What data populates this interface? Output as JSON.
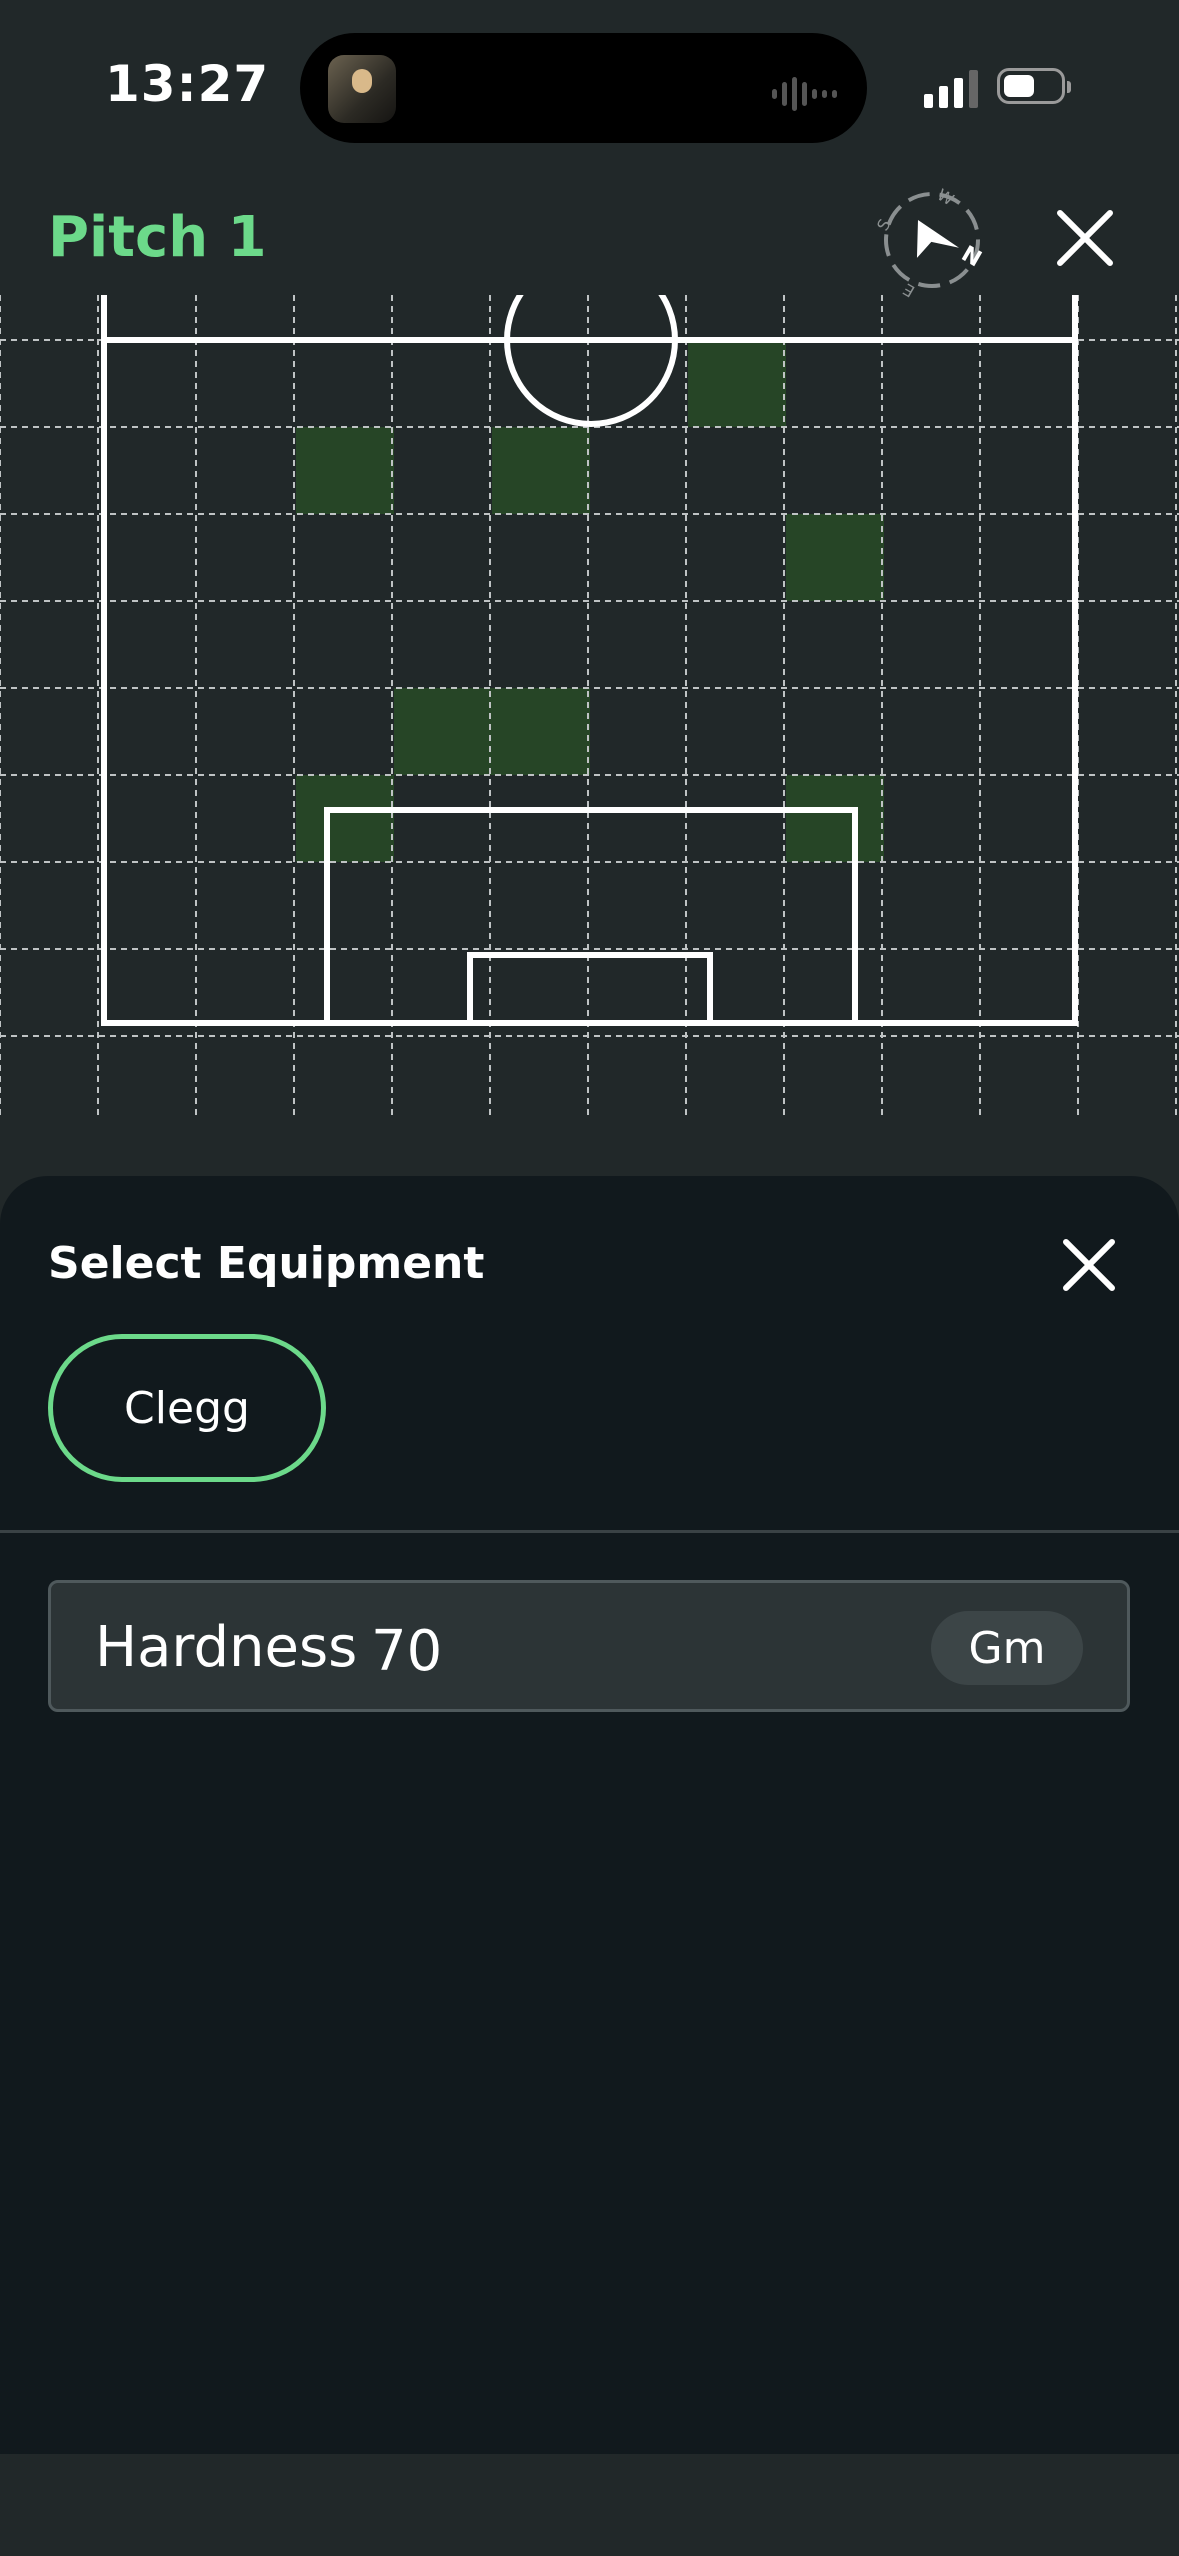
{
  "status_bar": {
    "time": "13:27"
  },
  "header": {
    "title": "Pitch 1",
    "compass_icon": "compass-icon",
    "close_icon": "close-icon"
  },
  "pitch": {
    "grid_cols": 12,
    "grid_rows": 9,
    "highlighted_cells": [
      [
        2,
        1
      ],
      [
        4,
        1
      ],
      [
        6,
        0
      ],
      [
        7,
        2
      ],
      [
        3,
        4
      ],
      [
        4,
        4
      ],
      [
        2,
        5
      ],
      [
        7,
        5
      ]
    ],
    "highlight_color": "#264526",
    "line_color": "#ffffff"
  },
  "equipment_sheet": {
    "title": "Select Equipment",
    "options": [
      {
        "label": "Clegg",
        "selected": true
      }
    ],
    "measurement": {
      "label": "Hardness",
      "value": "70",
      "unit": "Gm"
    }
  },
  "colors": {
    "accent": "#6cd98a",
    "background": "#212829",
    "sheet": "#11191d"
  }
}
